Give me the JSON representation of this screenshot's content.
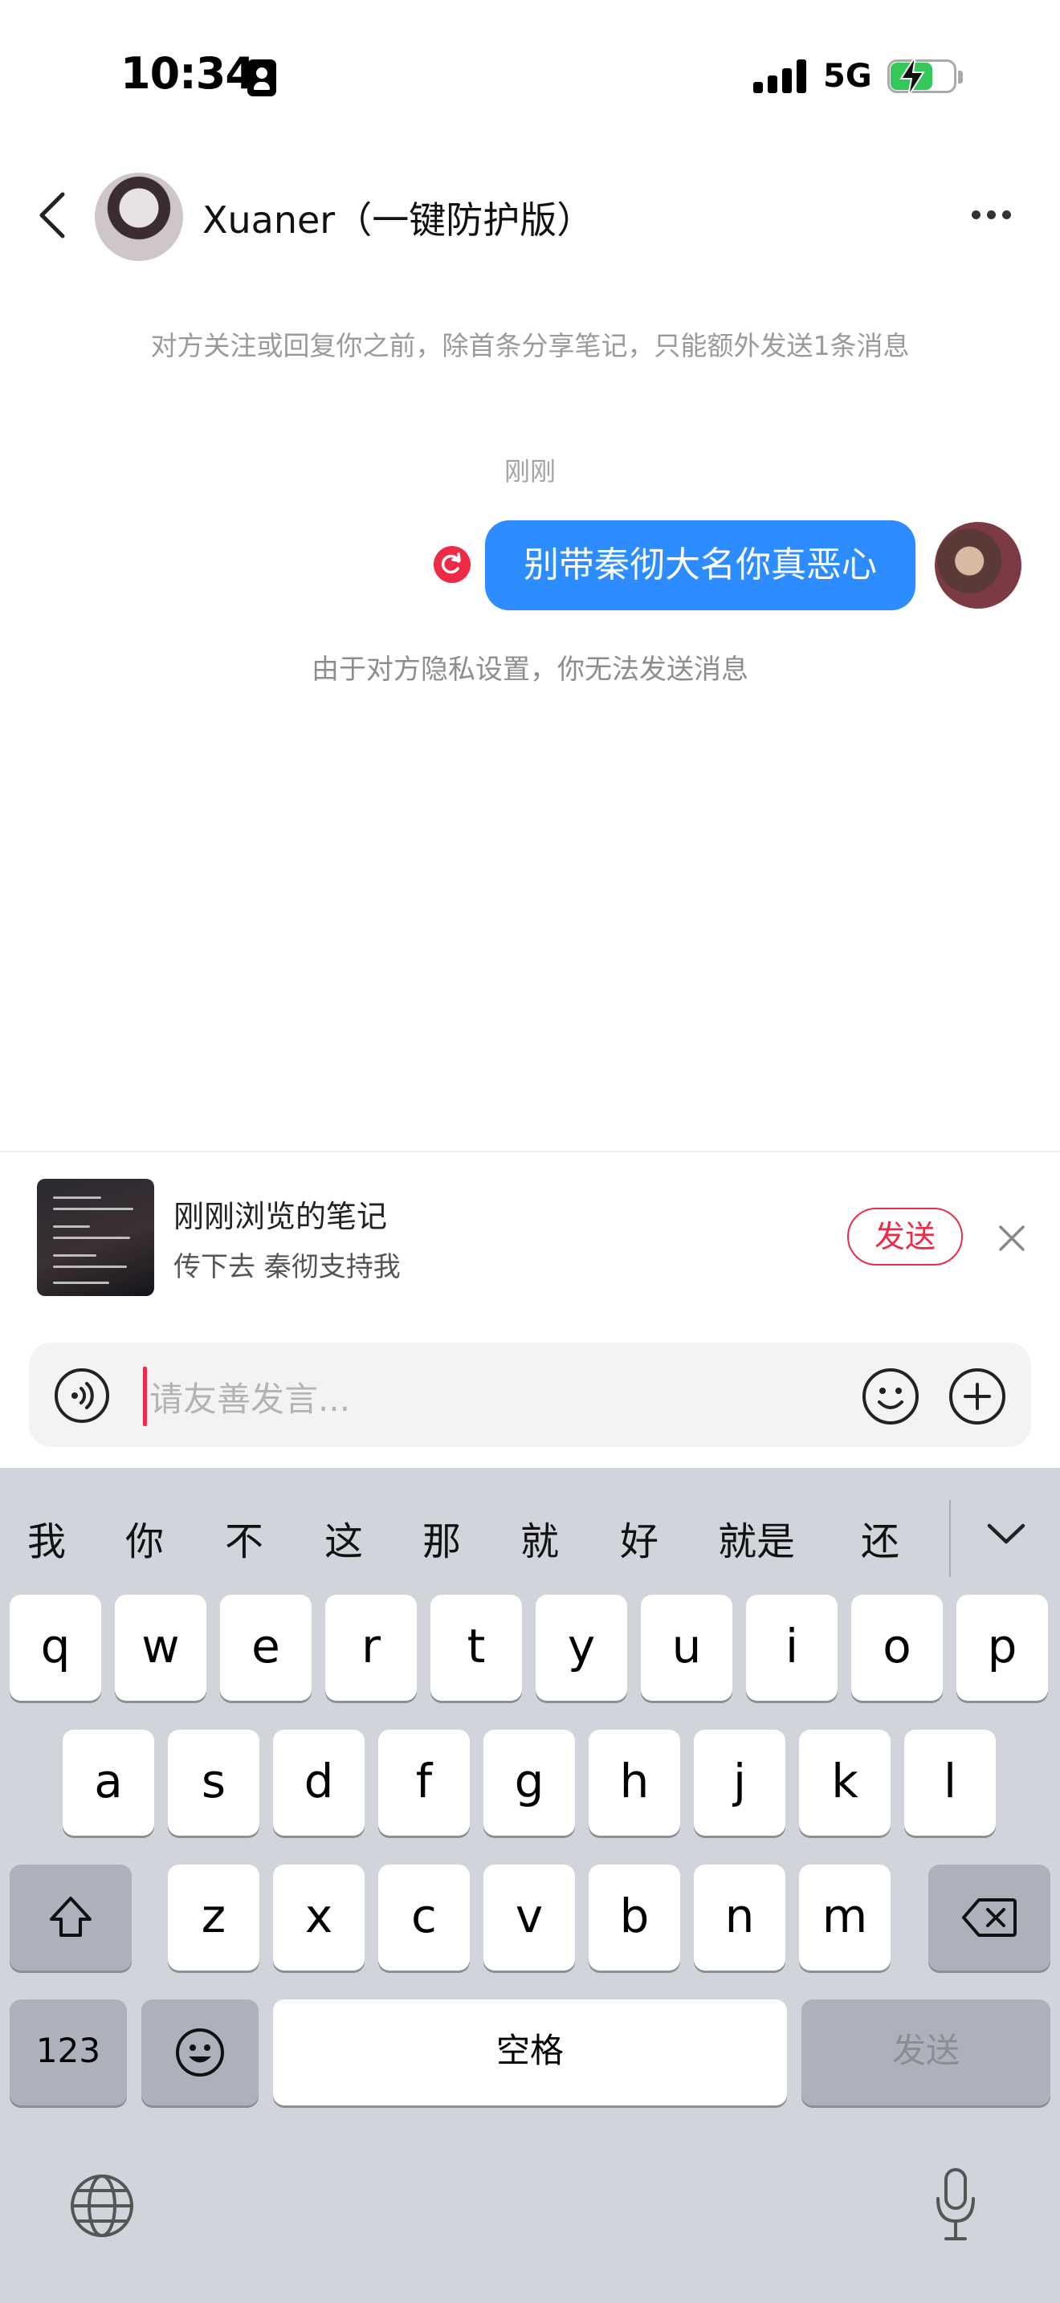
{
  "status_bar": {
    "time": "10:34",
    "network": "5G"
  },
  "header": {
    "title": "Xuaner（一键防护版）"
  },
  "chat": {
    "notice": "对方关注或回复你之前，除首条分享笔记，只能额外发送1条消息",
    "time_label": "刚刚",
    "message": "别带秦彻大名你真恶心",
    "privacy_notice": "由于对方隐私设置，你无法发送消息"
  },
  "shared_note": {
    "title": "刚刚浏览的笔记",
    "subtitle": "传下去 秦彻支持我",
    "send_label": "发送"
  },
  "input": {
    "placeholder": "请友善发言..."
  },
  "keyboard": {
    "candidates": [
      "我",
      "你",
      "不",
      "这",
      "那",
      "就",
      "好",
      "就是",
      "还"
    ],
    "row1": [
      "q",
      "w",
      "e",
      "r",
      "t",
      "y",
      "u",
      "i",
      "o",
      "p"
    ],
    "row2": [
      "a",
      "s",
      "d",
      "f",
      "g",
      "h",
      "j",
      "k",
      "l"
    ],
    "row3": [
      "z",
      "x",
      "c",
      "v",
      "b",
      "n",
      "m"
    ],
    "numbers_label": "123",
    "space_label": "空格",
    "send_label": "发送"
  },
  "colors": {
    "accent_red": "#ee2a46",
    "bubble_blue": "#2d8cff",
    "battery_green": "#34c759",
    "keyboard_bg": "#d1d4db"
  }
}
